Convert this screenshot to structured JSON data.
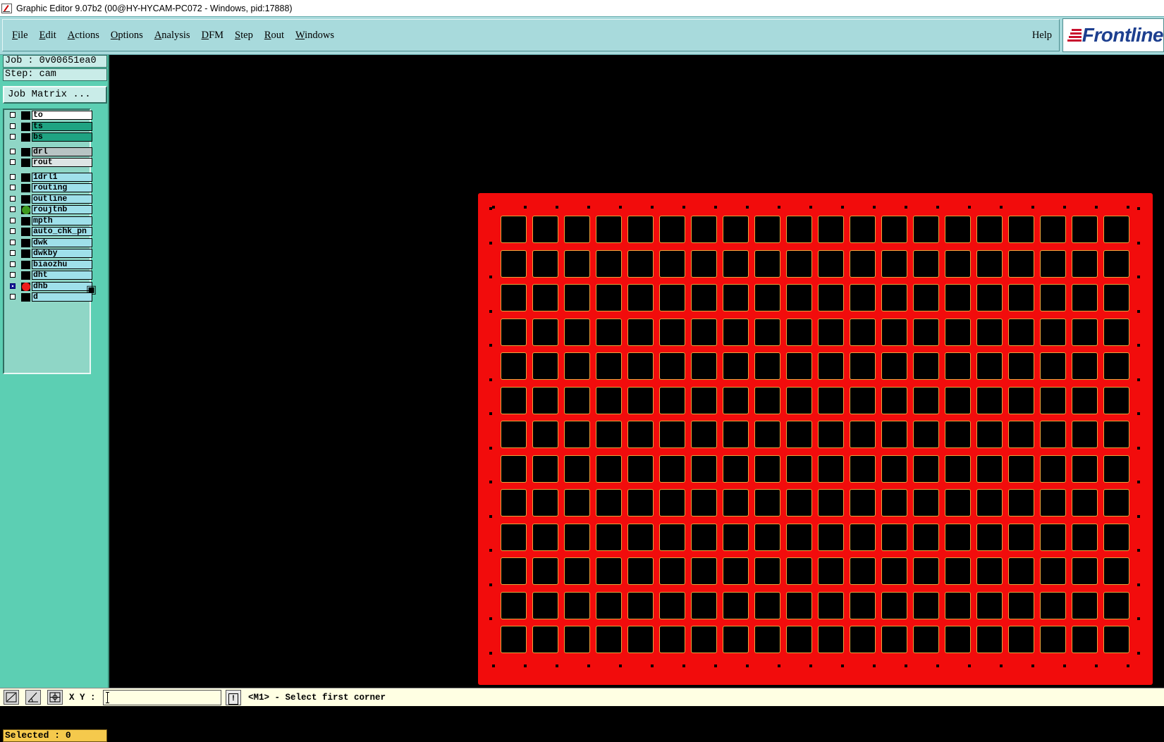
{
  "window": {
    "title": "Graphic Editor 9.07b2 (00@HY-HYCAM-PC072 - Windows, pid:17888)"
  },
  "menu": {
    "items": [
      "File",
      "Edit",
      "Actions",
      "Options",
      "Analysis",
      "DFM",
      "Step",
      "Rout",
      "Windows"
    ],
    "help": "Help"
  },
  "logo": {
    "text": "Frontline",
    "brand_color": "#1d3f8f",
    "accent_color": "#c8102e"
  },
  "job": {
    "job_label": "Job : 0v00651ea0",
    "step_label": "Step: cam",
    "matrix_button": "Job Matrix ..."
  },
  "layers": [
    {
      "name": "to",
      "bg": "#ffffff",
      "group": 0,
      "dot": null,
      "active": false
    },
    {
      "name": "ts",
      "bg": "#1fa382",
      "group": 0,
      "dot": null,
      "active": false
    },
    {
      "name": "bs",
      "bg": "#1fa382",
      "group": 0,
      "dot": null,
      "active": false
    },
    {
      "name": "drl",
      "bg": "#b8c4c4",
      "group": 1,
      "dot": null,
      "active": false
    },
    {
      "name": "rout",
      "bg": "#dde4e4",
      "group": 1,
      "dot": null,
      "active": false
    },
    {
      "name": "1drl1",
      "bg": "#9fe0ea",
      "group": 2,
      "dot": null,
      "active": false
    },
    {
      "name": "routing",
      "bg": "#9fe0ea",
      "group": 2,
      "dot": null,
      "active": false
    },
    {
      "name": "outline",
      "bg": "#9fe0ea",
      "group": 2,
      "dot": null,
      "active": false
    },
    {
      "name": "roujtnb",
      "bg": "#9fe0ea",
      "group": 2,
      "dot": "#3e9a1f",
      "active": false
    },
    {
      "name": "mpth",
      "bg": "#9fe0ea",
      "group": 2,
      "dot": null,
      "active": false
    },
    {
      "name": "auto_chk_pn",
      "bg": "#9fe0ea",
      "group": 2,
      "dot": null,
      "active": false
    },
    {
      "name": "dwk",
      "bg": "#9fe0ea",
      "group": 2,
      "dot": null,
      "active": false
    },
    {
      "name": "dwkby",
      "bg": "#9fe0ea",
      "group": 2,
      "dot": null,
      "active": false
    },
    {
      "name": "biaozhu",
      "bg": "#9fe0ea",
      "group": 2,
      "dot": null,
      "active": false
    },
    {
      "name": "dht",
      "bg": "#9fe0ea",
      "group": 2,
      "dot": null,
      "active": false
    },
    {
      "name": "dhb",
      "bg": "#9fe0ea",
      "group": 2,
      "dot": "#ee1c1c",
      "active": true
    },
    {
      "name": "d",
      "bg": "#9fe0ea",
      "group": 2,
      "dot": null,
      "active": false
    }
  ],
  "status": {
    "selected": "Selected : 0",
    "xy_label": "X Y :",
    "xy_value": "",
    "prompt": "<M1> - Select first corner"
  },
  "board": {
    "panel_color": "#f20c0c",
    "cell_outline_color": "#e8a53c",
    "columns": 20,
    "rows": 13
  }
}
